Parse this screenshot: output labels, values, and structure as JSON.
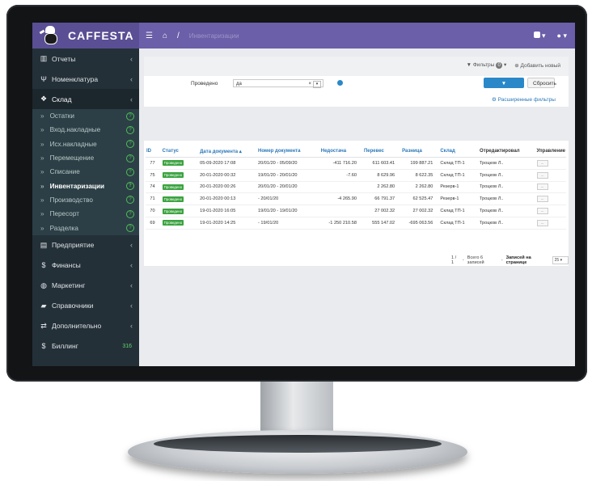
{
  "app": {
    "name": "CAFFESTA"
  },
  "topbar": {
    "menu_icon": "menu-icon",
    "home_icon": "home-icon",
    "separator": "/",
    "breadcrumb": "Инвентаризации"
  },
  "sidebar": {
    "items": [
      {
        "label": "Отчеты",
        "icon": "chart-icon"
      },
      {
        "label": "Номенклатура",
        "icon": "fork-icon"
      },
      {
        "label": "Склад",
        "icon": "cubes-icon"
      }
    ],
    "sub_items": [
      {
        "label": "Остатки"
      },
      {
        "label": "Вход.накладные"
      },
      {
        "label": "Исх.накладные"
      },
      {
        "label": "Перемещение"
      },
      {
        "label": "Списание"
      },
      {
        "label": "Инвентаризации"
      },
      {
        "label": "Производство"
      },
      {
        "label": "Пересорт"
      },
      {
        "label": "Разделка"
      }
    ],
    "items2": [
      {
        "label": "Предприятие",
        "icon": "building-icon"
      },
      {
        "label": "Финансы",
        "icon": "dollar-icon"
      },
      {
        "label": "Маркетинг",
        "icon": "globe-icon"
      },
      {
        "label": "Справочники",
        "icon": "book-icon"
      },
      {
        "label": "Дополнительно",
        "icon": "exchange-icon"
      },
      {
        "label": "Биллинг",
        "icon": "dollar-icon",
        "badge": "316"
      }
    ]
  },
  "toolbar": {
    "filters_label": "Фильтры",
    "filters_count": "0",
    "add_label": "Добавить новый"
  },
  "filter": {
    "label": "Проведено",
    "value": "да",
    "apply": "Фильтровать",
    "reset": "Сбросить",
    "advanced": "Расширенные фильтры"
  },
  "table": {
    "headers": [
      "ID",
      "Статус",
      "Дата документа ▴",
      "Номер документа",
      "Недостача",
      "Перевес",
      "Разница",
      "Склад",
      "Отредактировал",
      "Управление"
    ],
    "rows": [
      [
        "77",
        "Проведено",
        "05-09-2020 17:08",
        "20/01/20 - 05/09/20",
        "-411 716.20",
        "611 603.41",
        "199 887.21",
        "Склад ТП-1",
        "Троцков Л.."
      ],
      [
        "75",
        "Проведено",
        "20-01-2020 00:32",
        "19/01/20 - 20/01/20",
        "-7.60",
        "8 629.96",
        "8 622.35",
        "Склад ТП-1",
        "Троцков Л.."
      ],
      [
        "74",
        "Проведено",
        "20-01-2020 00:26",
        "20/01/20 - 20/01/20",
        "",
        "2 262.80",
        "2 262.80",
        "Резерв-1",
        "Троцков Л.."
      ],
      [
        "71",
        "Проведено",
        "20-01-2020 00:13",
        "- 20/01/20",
        "-4 265.90",
        "66 791.37",
        "62 525.47",
        "Резерв-1",
        "Троцков Л.."
      ],
      [
        "70",
        "Проведено",
        "19-01-2020 16:05",
        "19/01/20 - 19/01/20",
        "",
        "27 002.32",
        "27 002.32",
        "Склад ТП-1",
        "Троцков Л.."
      ],
      [
        "69",
        "Проведено",
        "19-01-2020 14:25",
        "- 19/01/20",
        "-1 250 210.58",
        "555 147.02",
        "-695 063.56",
        "Склад ТП-1",
        "Троцков Л.."
      ]
    ],
    "action_label": "..."
  },
  "pager": {
    "pages": "1 / 1",
    "total": "Всего 6 записей",
    "per_page_label": "Записей на странице",
    "per_page": "25"
  },
  "colors": {
    "topbar": "#6a5fa8",
    "sidebar": "#243038",
    "accent": "#2a88c9",
    "status_ok": "#3aa33f"
  }
}
